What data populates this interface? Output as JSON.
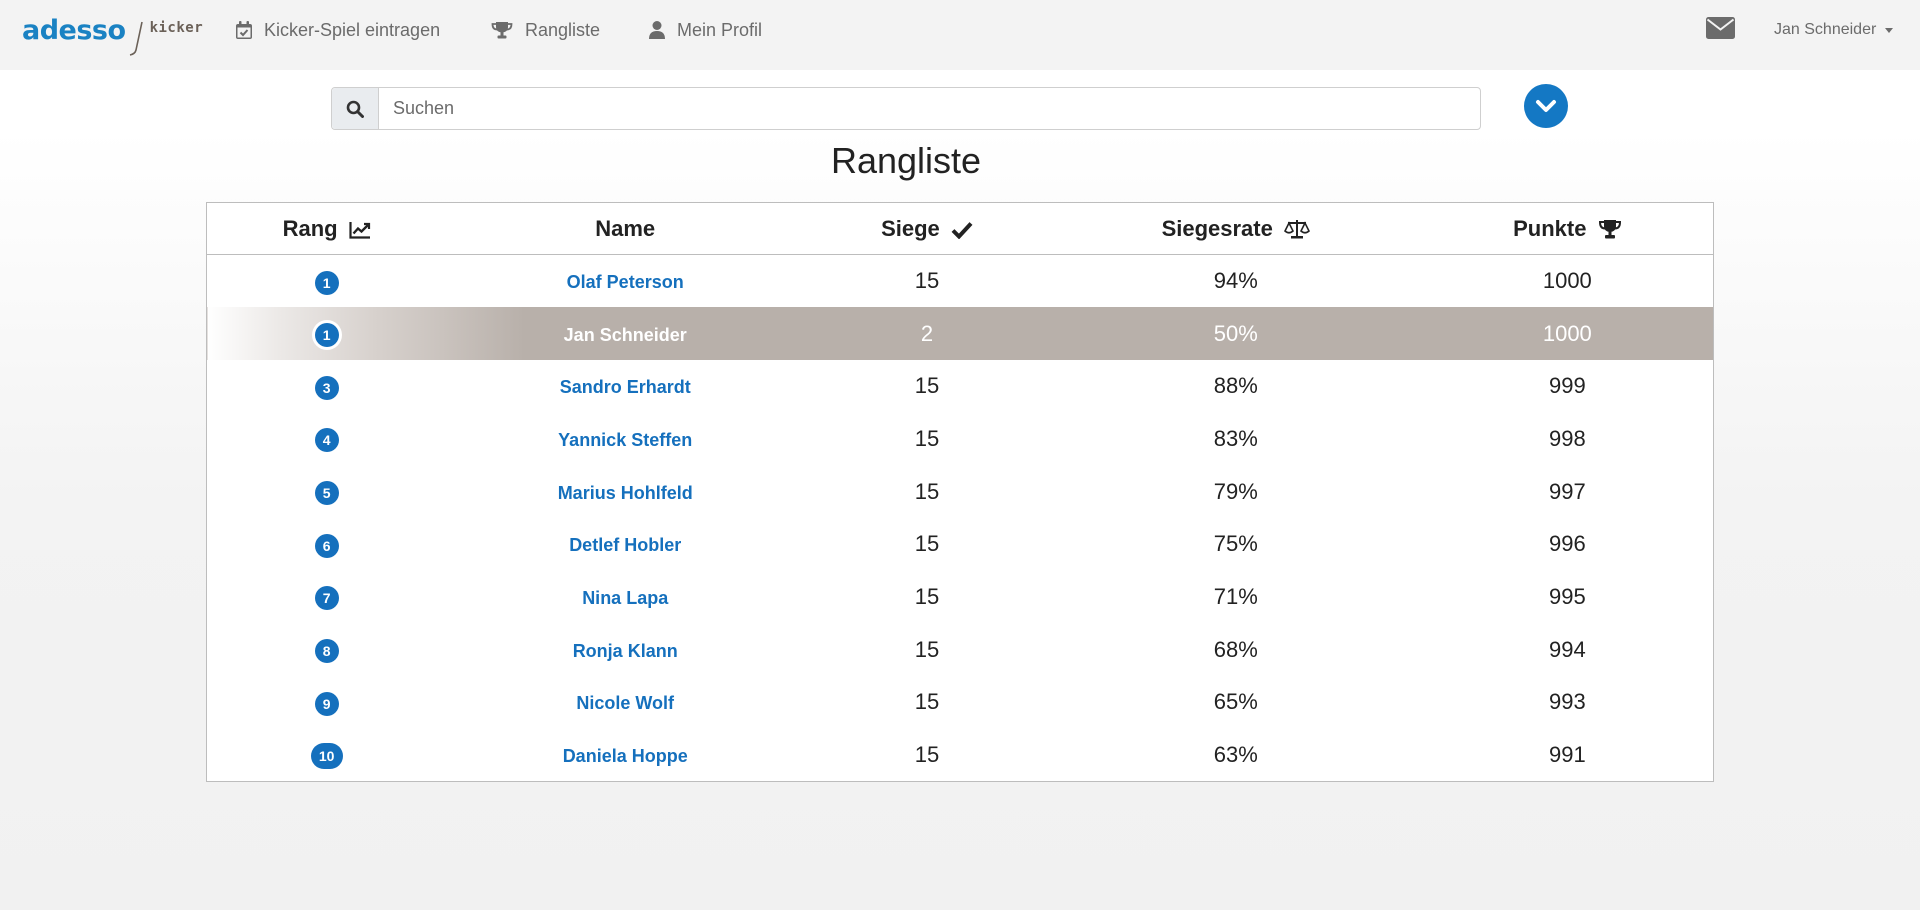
{
  "brand": {
    "name": "adesso",
    "product": "kicker"
  },
  "nav": {
    "items": [
      {
        "label": "Kicker-Spiel eintragen",
        "icon": "calendar-check-icon"
      },
      {
        "label": "Rangliste",
        "icon": "trophy-icon"
      },
      {
        "label": "Mein Profil",
        "icon": "user-icon"
      }
    ],
    "mail_icon": "envelope-icon",
    "user_name": "Jan Schneider"
  },
  "search": {
    "placeholder": "Suchen",
    "value": ""
  },
  "page": {
    "title": "Rangliste"
  },
  "table": {
    "headers": [
      {
        "label": "Rang",
        "icon": "chart-line-icon"
      },
      {
        "label": "Name",
        "icon": ""
      },
      {
        "label": "Siege",
        "icon": "check-icon"
      },
      {
        "label": "Siegesrate",
        "icon": "balance-scale-icon"
      },
      {
        "label": "Punkte",
        "icon": "trophy-icon"
      }
    ],
    "rows": [
      {
        "rank": "1",
        "name": "Olaf Peterson",
        "wins": "15",
        "rate": "94%",
        "points": "1000",
        "highlight": false
      },
      {
        "rank": "1",
        "name": "Jan Schneider",
        "wins": "2",
        "rate": "50%",
        "points": "1000",
        "highlight": true
      },
      {
        "rank": "3",
        "name": "Sandro Erhardt",
        "wins": "15",
        "rate": "88%",
        "points": "999",
        "highlight": false
      },
      {
        "rank": "4",
        "name": "Yannick Steffen",
        "wins": "15",
        "rate": "83%",
        "points": "998",
        "highlight": false
      },
      {
        "rank": "5",
        "name": "Marius Hohlfeld",
        "wins": "15",
        "rate": "79%",
        "points": "997",
        "highlight": false
      },
      {
        "rank": "6",
        "name": "Detlef Hobler",
        "wins": "15",
        "rate": "75%",
        "points": "996",
        "highlight": false
      },
      {
        "rank": "7",
        "name": "Nina Lapa",
        "wins": "15",
        "rate": "71%",
        "points": "995",
        "highlight": false
      },
      {
        "rank": "8",
        "name": "Ronja Klann",
        "wins": "15",
        "rate": "68%",
        "points": "994",
        "highlight": false
      },
      {
        "rank": "9",
        "name": "Nicole Wolf",
        "wins": "15",
        "rate": "65%",
        "points": "993",
        "highlight": false
      },
      {
        "rank": "10",
        "name": "Daniela Hoppe",
        "wins": "15",
        "rate": "63%",
        "points": "991",
        "highlight": false
      }
    ]
  },
  "colors": {
    "accent": "#1570bd",
    "brand_blue": "#1a82c3",
    "highlight_row": "#b8b0aa",
    "navbar_bg": "#f3f3f3"
  }
}
